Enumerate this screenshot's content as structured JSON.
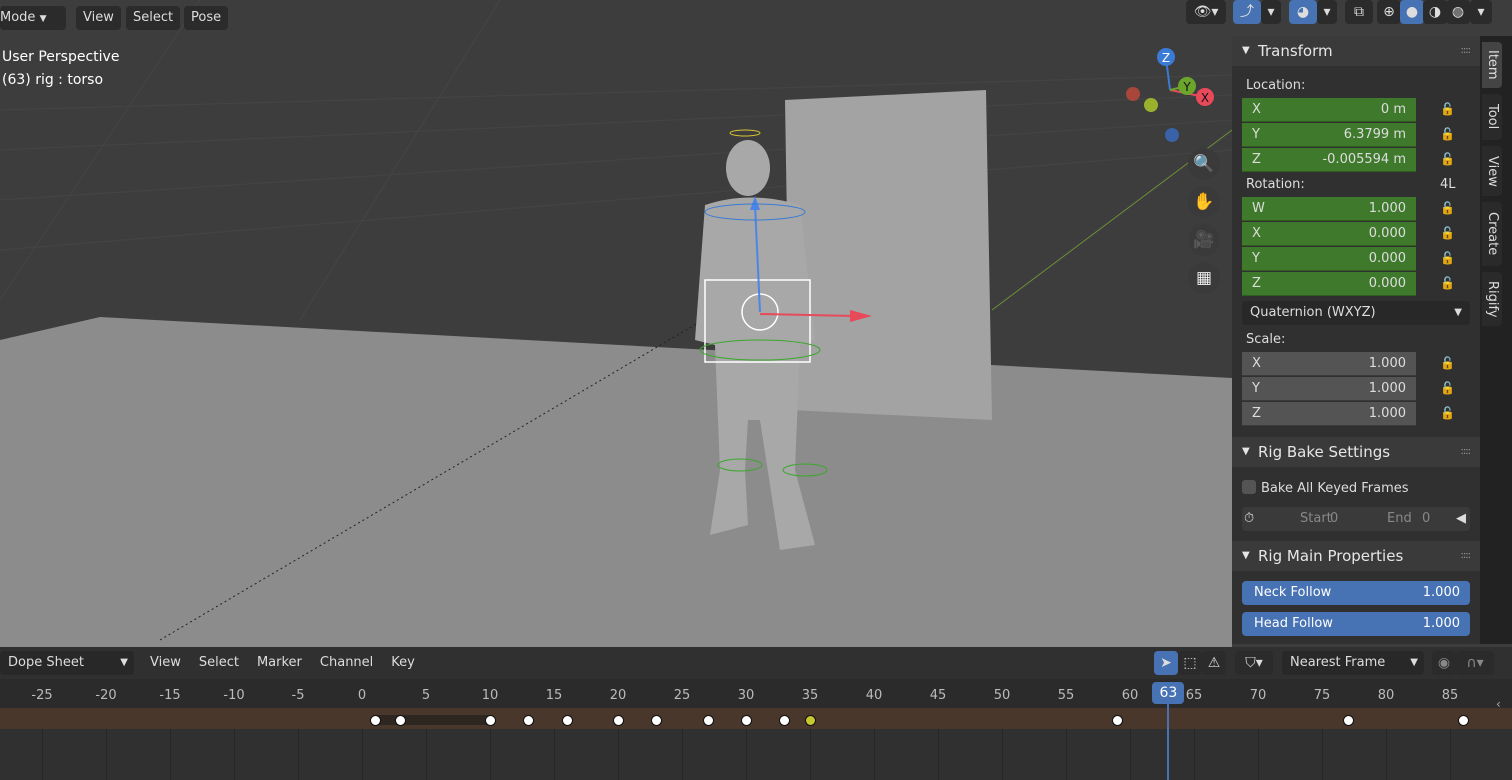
{
  "header": {
    "mode": "Mode",
    "menus": [
      "View",
      "Select",
      "Pose"
    ]
  },
  "viewport": {
    "info": [
      "User Perspective",
      "(63) rig : torso"
    ],
    "gizmo": {
      "z": "Z",
      "y": "Y",
      "x": "X"
    }
  },
  "colors": {
    "accent": "#4772b3",
    "green_field": "#3f7a2c",
    "keyframe_selected": "#c9c72e",
    "playhead": "#4772b3"
  },
  "sidebar": {
    "tabs": [
      "Item",
      "Tool",
      "View",
      "Create",
      "Rigify"
    ],
    "transform": {
      "title": "Transform",
      "location_label": "Location:",
      "location": [
        {
          "axis": "X",
          "value": "0 m"
        },
        {
          "axis": "Y",
          "value": "6.3799 m"
        },
        {
          "axis": "Z",
          "value": "-0.005594 m"
        }
      ],
      "rotation_label": "Rotation:",
      "rotation_lock": "4L",
      "rotation": [
        {
          "axis": "W",
          "value": "1.000"
        },
        {
          "axis": "X",
          "value": "0.000"
        },
        {
          "axis": "Y",
          "value": "0.000"
        },
        {
          "axis": "Z",
          "value": "0.000"
        }
      ],
      "rotation_mode": "Quaternion (WXYZ)",
      "scale_label": "Scale:",
      "scale": [
        {
          "axis": "X",
          "value": "1.000"
        },
        {
          "axis": "Y",
          "value": "1.000"
        },
        {
          "axis": "Z",
          "value": "1.000"
        }
      ]
    },
    "bake": {
      "title": "Rig Bake Settings",
      "checkbox": "Bake All Keyed Frames",
      "start_label": "Start",
      "start": "0",
      "end_label": "End",
      "end": "0"
    },
    "main": {
      "title": "Rig Main Properties",
      "sliders": [
        {
          "label": "Neck Follow",
          "value": "1.000"
        },
        {
          "label": "Head Follow",
          "value": "1.000"
        }
      ]
    }
  },
  "dopesheet": {
    "editor": "Dope Sheet",
    "menus": [
      "View",
      "Select",
      "Marker",
      "Channel",
      "Key"
    ],
    "snap": "Nearest Frame",
    "ticks": [
      -25,
      -20,
      -15,
      -10,
      -5,
      0,
      5,
      10,
      15,
      20,
      25,
      30,
      35,
      40,
      45,
      50,
      55,
      60,
      65,
      70,
      75,
      80,
      85
    ],
    "current_frame": 63,
    "keyframes": [
      1,
      3,
      10,
      13,
      16,
      20,
      23,
      27,
      30,
      33,
      35,
      59,
      77,
      86
    ],
    "selected_keyframe": 35
  }
}
